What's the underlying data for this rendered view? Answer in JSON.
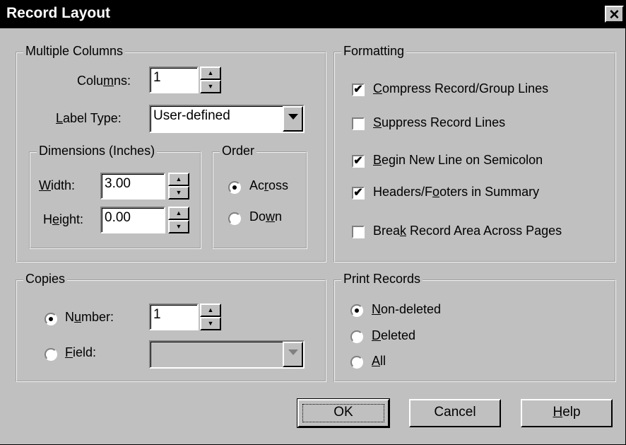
{
  "window": {
    "title": "Record Layout",
    "close_glyph": "✕"
  },
  "multiple_columns": {
    "legend": "Multiple Columns",
    "columns_label_a": "Colu",
    "columns_label_u": "m",
    "columns_label_b": "ns:",
    "columns_value": "1",
    "label_type_u": "L",
    "label_type_rest": "abel Type:",
    "label_type_value": "User-defined",
    "dimensions": {
      "legend": "Dimensions (Inches)",
      "width_u": "W",
      "width_rest": "idth:",
      "width_value": "3.00",
      "height_a": "H",
      "height_u": "e",
      "height_b": "ight:",
      "height_value": "0.00"
    },
    "order": {
      "legend": "Order",
      "across_a": "Ac",
      "across_u": "r",
      "across_b": "oss",
      "down_a": "Do",
      "down_u": "w",
      "down_b": "n",
      "selected": "Across"
    }
  },
  "formatting": {
    "legend": "Formatting",
    "items": [
      {
        "u": "C",
        "rest": "ompress Record/Group Lines",
        "checked": true
      },
      {
        "u": "S",
        "rest": "uppress Record Lines",
        "checked": false
      },
      {
        "u": "B",
        "rest": "egin New Line on Semicolon",
        "checked": true
      },
      {
        "pre": "Headers/F",
        "u": "o",
        "rest": "oters in Summary",
        "checked": true
      },
      {
        "pre": "Brea",
        "u": "k",
        "rest": " Record Area Across Pages",
        "checked": false
      }
    ]
  },
  "copies": {
    "legend": "Copies",
    "number_a": "N",
    "number_u": "u",
    "number_b": "mber:",
    "number_value": "1",
    "field_u": "F",
    "field_rest": "ield:",
    "field_value": "",
    "selected": "Number"
  },
  "print_records": {
    "legend": "Print Records",
    "options": [
      {
        "u": "N",
        "rest": "on-deleted",
        "selected": true
      },
      {
        "u": "D",
        "rest": "eleted",
        "selected": false
      },
      {
        "u": "A",
        "rest": "ll",
        "selected": false
      }
    ]
  },
  "buttons": {
    "ok": "OK",
    "cancel": "Cancel",
    "help_u": "H",
    "help_rest": "elp"
  },
  "icons": {
    "spin_up": "▲",
    "spin_down": "▼",
    "combo": "chevron-down-icon",
    "check": "✔"
  }
}
